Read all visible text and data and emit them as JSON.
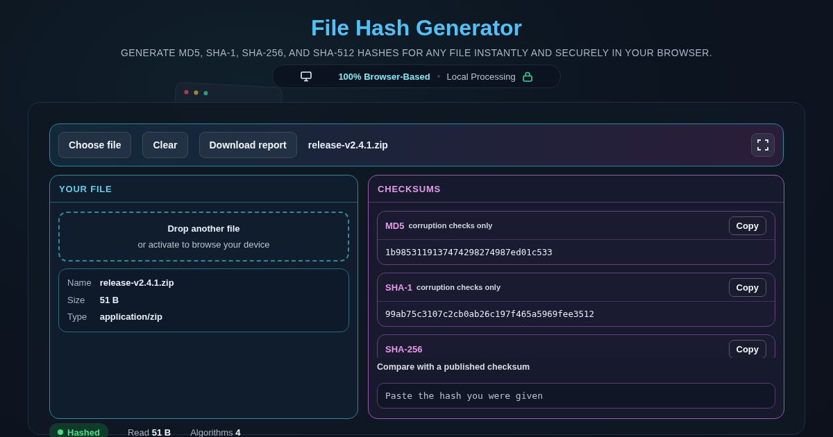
{
  "header": {
    "title": "File Hash Generator",
    "subtitle": "GENERATE MD5, SHA-1, SHA-256, AND SHA-512 HASHES FOR ANY FILE INSTANTLY AND SECURELY IN YOUR BROWSER.",
    "badge": {
      "primary": "100% Browser-Based",
      "secondary": "Local Processing"
    }
  },
  "toolbar": {
    "buttons": [
      "Choose file",
      "Clear",
      "Download report"
    ],
    "file_name": "release-v2.4.1.zip"
  },
  "your_file": {
    "title": "YOUR FILE",
    "dropzone": {
      "title": "Drop another file",
      "hint": "or activate to browse your device"
    },
    "details": [
      {
        "label": "Name",
        "value": "release-v2.4.1.zip"
      },
      {
        "label": "Size",
        "value": "51 B"
      },
      {
        "label": "Type",
        "value": "application/zip"
      }
    ]
  },
  "checksums": {
    "title": "CHECKSUMS",
    "hashes": [
      {
        "name": "MD5",
        "note": "corruption checks only",
        "value": "1b9853119137474298274987ed01c533",
        "copy": "Copy"
      },
      {
        "name": "SHA-1",
        "note": "corruption checks only",
        "value": "99ab75c3107c2cb0ab26c197f465a5969fee3512",
        "copy": "Copy"
      },
      {
        "name": "SHA-256",
        "copy": "Copy"
      }
    ],
    "compare": {
      "label": "Compare with a published checksum",
      "placeholder": "Paste the hash you were given"
    }
  },
  "status_bar": {
    "state": "Hashed",
    "items": [
      "Read **51 B**",
      "Algorithms **4**"
    ]
  }
}
